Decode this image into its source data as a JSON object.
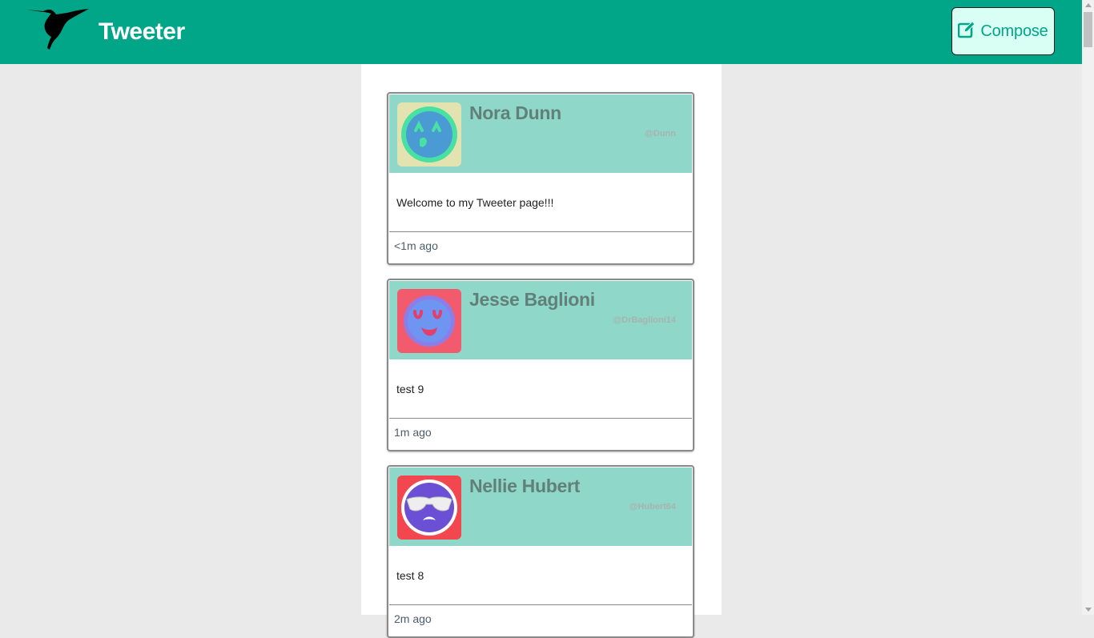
{
  "header": {
    "brand": "Tweeter",
    "compose_label": "Compose",
    "logo_icon": "hummingbird-icon",
    "compose_icon": "edit-icon"
  },
  "colors": {
    "nav_bg": "#00a687",
    "tweet_header_bg": "#8fd7c8",
    "page_bg": "#eaeaea",
    "compose_bg": "#d9fff4"
  },
  "tweets": [
    {
      "name": "Nora Dunn",
      "handle": "@Dunn",
      "body": "Welcome to my Tweeter page!!!",
      "time": "<1m ago",
      "avatar_icon": "emoji-avatar-icon"
    },
    {
      "name": "Jesse Baglioni",
      "handle": "@DrBaglioni14",
      "body": "test 9",
      "time": "1m ago",
      "avatar_icon": "emoji-avatar-icon"
    },
    {
      "name": "Nellie Hubert",
      "handle": "@Hubert64",
      "body": "test 8",
      "time": "2m ago",
      "avatar_icon": "sunglasses-avatar-icon"
    }
  ]
}
